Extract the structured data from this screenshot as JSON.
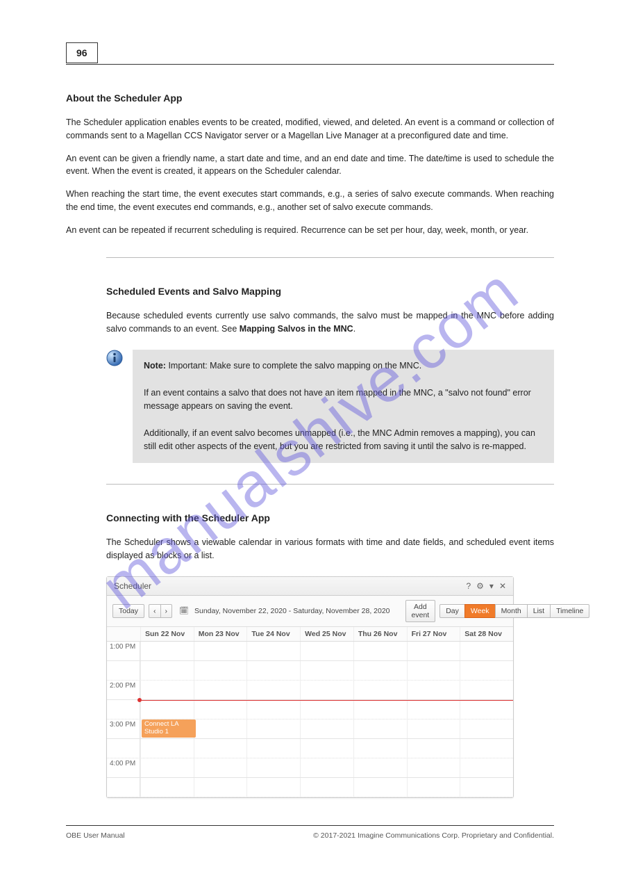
{
  "page": {
    "number": "96",
    "footer_left": "OBE User Manual",
    "footer_right": "© 2017-2021 Imagine Communications Corp. Proprietary and Confidential."
  },
  "watermark": "manualshive.com",
  "section1": {
    "heading": "About the Scheduler App",
    "p1": "The Scheduler application enables events to be created, modified, viewed, and deleted. An event is a command or collection of commands sent to a Magellan CCS Navigator server or a Magellan Live Manager at a preconfigured date and time.",
    "p2": "An event can be given a friendly name, a start date and time, and an end date and time. The date/time is used to schedule the event. When the event is created, it appears on the Scheduler calendar.",
    "p3": "When reaching the start time, the event executes start commands, e.g., a series of salvo execute commands. When reaching the end time, the event executes end commands, e.g., another set of salvo execute commands.",
    "p4": "An event can be repeated if recurrent scheduling is required. Recurrence can be set per hour, day, week, month, or year."
  },
  "section2": {
    "heading": "Scheduled Events and Salvo Mapping",
    "p1": "Because scheduled events currently use salvo commands, the salvo must be mapped in the MNC before adding salvo commands to an event. See ",
    "p1_link": "Mapping Salvos in the MNC"
  },
  "note": {
    "label": "Note:",
    "lines": [
      "Important: Make sure to complete the salvo mapping on the MNC.",
      "If an event contains a salvo that does not have an item mapped in the MNC, a \"salvo not found\" error message appears on saving the event.",
      "Additionally, if an event salvo becomes unmapped (i.e., the MNC Admin removes a mapping), you can still edit other aspects of the event, but you are restricted from saving it until the salvo is re-mapped."
    ]
  },
  "section3": {
    "heading": "Connecting with the Scheduler App",
    "p1": "The Scheduler shows a viewable calendar in various formats with time and date fields, and scheduled event items displayed as blocks or a list."
  },
  "scheduler": {
    "title": "Scheduler",
    "today": "Today",
    "prev": "‹",
    "next": "›",
    "date_range": "Sunday, November 22, 2020 - Saturday, November 28, 2020",
    "add_event": "Add event",
    "views": [
      "Day",
      "Week",
      "Month",
      "List",
      "Timeline"
    ],
    "active_view": "Week",
    "day_headers": [
      "Sun 22 Nov",
      "Mon 23 Nov",
      "Tue 24 Nov",
      "Wed 25 Nov",
      "Thu 26 Nov",
      "Fri 27 Nov",
      "Sat 28 Nov"
    ],
    "time_slots": [
      "1:00 PM",
      "2:00 PM",
      "3:00 PM",
      "4:00 PM"
    ],
    "event": {
      "title": "Connect LA Studio 1"
    },
    "title_icons": {
      "help": "?",
      "settings": "⚙",
      "dropdown": "▾",
      "close": "✕"
    }
  }
}
